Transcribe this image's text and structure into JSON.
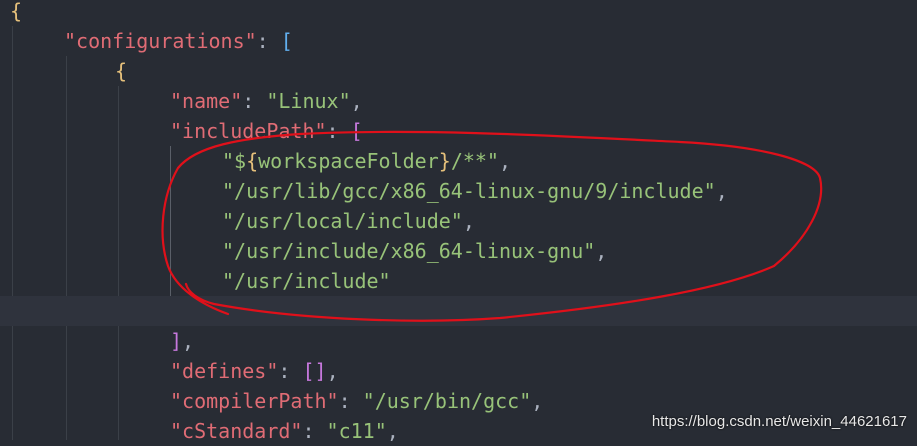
{
  "colors": {
    "background": "#282c34",
    "current_line": "#2f333d",
    "punctuation": "#abb2bf",
    "key": "#e06c75",
    "string": "#98c379",
    "brace_outer": "#e5c07b",
    "bracket_blue": "#61afef",
    "bracket_purple": "#c678dd",
    "annotation": "#e0101a"
  },
  "code_lines": [
    [
      {
        "t": "{",
        "c": "brace_outer"
      }
    ],
    [
      {
        "t": "\"configurations\"",
        "c": "key"
      },
      {
        "t": ": ",
        "c": "punctuation"
      },
      {
        "t": "[",
        "c": "bracket_blue"
      }
    ],
    [
      {
        "t": "{",
        "c": "brace_outer"
      }
    ],
    [
      {
        "t": "\"name\"",
        "c": "key"
      },
      {
        "t": ": ",
        "c": "punctuation"
      },
      {
        "t": "\"Linux\"",
        "c": "string"
      },
      {
        "t": ",",
        "c": "punctuation"
      }
    ],
    [
      {
        "t": "\"includePath\"",
        "c": "key"
      },
      {
        "t": ": ",
        "c": "punctuation"
      },
      {
        "t": "[",
        "c": "bracket_purple"
      }
    ],
    [
      {
        "t": "\"$",
        "c": "string"
      },
      {
        "t": "{",
        "c": "brace_outer"
      },
      {
        "t": "workspaceFolder",
        "c": "string"
      },
      {
        "t": "}",
        "c": "brace_outer"
      },
      {
        "t": "/**\"",
        "c": "string"
      },
      {
        "t": ",",
        "c": "punctuation"
      }
    ],
    [
      {
        "t": "\"/usr/lib/gcc/x86_64-linux-gnu/9/include\"",
        "c": "string"
      },
      {
        "t": ",",
        "c": "punctuation"
      }
    ],
    [
      {
        "t": "\"/usr/local/include\"",
        "c": "string"
      },
      {
        "t": ",",
        "c": "punctuation"
      }
    ],
    [
      {
        "t": "\"/usr/include/x86_64-linux-gnu\"",
        "c": "string"
      },
      {
        "t": ",",
        "c": "punctuation"
      }
    ],
    [
      {
        "t": "\"/usr/include\"",
        "c": "string"
      }
    ],
    [],
    [
      {
        "t": "]",
        "c": "bracket_purple"
      },
      {
        "t": ",",
        "c": "punctuation"
      }
    ],
    [
      {
        "t": "\"defines\"",
        "c": "key"
      },
      {
        "t": ": ",
        "c": "punctuation"
      },
      {
        "t": "[]",
        "c": "bracket_purple"
      },
      {
        "t": ",",
        "c": "punctuation"
      }
    ],
    [
      {
        "t": "\"compilerPath\"",
        "c": "key"
      },
      {
        "t": ": ",
        "c": "punctuation"
      },
      {
        "t": "\"/usr/bin/gcc\"",
        "c": "string"
      },
      {
        "t": ",",
        "c": "punctuation"
      }
    ],
    [
      {
        "t": "\"cStandard\"",
        "c": "key"
      },
      {
        "t": ": ",
        "c": "punctuation"
      },
      {
        "t": "\"c11\"",
        "c": "string"
      },
      {
        "t": ",",
        "c": "punctuation"
      }
    ]
  ],
  "watermark": "https://blog.csdn.net/weixin_44621617"
}
